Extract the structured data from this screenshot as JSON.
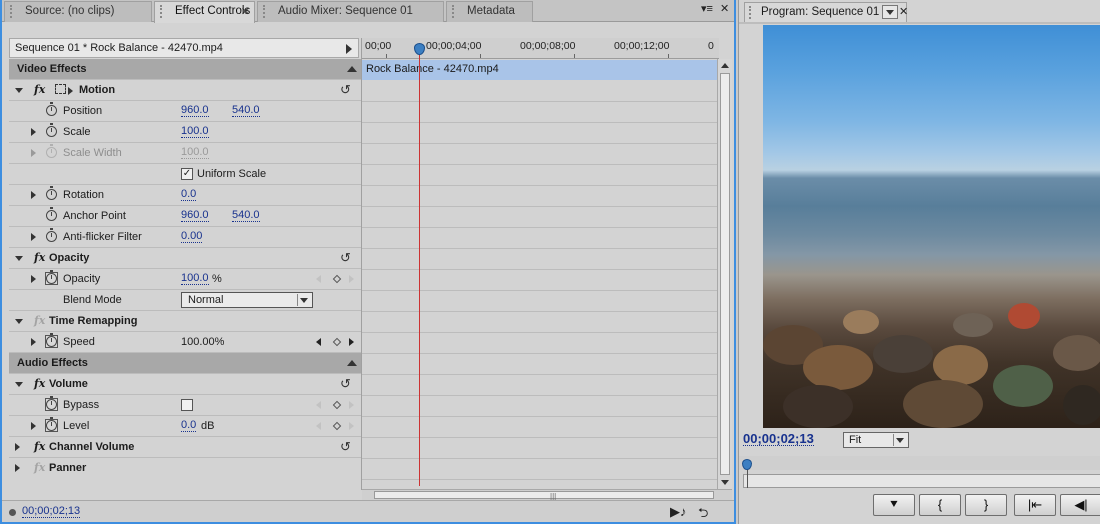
{
  "tabs": [
    {
      "label": "Source: (no clips)",
      "active": false
    },
    {
      "label": "Effect Controls",
      "active": true
    },
    {
      "label": "Audio Mixer: Sequence 01",
      "active": false
    },
    {
      "label": "Metadata",
      "active": false
    }
  ],
  "sequence_header": "Sequence 01 * Rock Balance - 42470.mp4",
  "ruler_ticks": [
    "00;00",
    "00;00;04;00",
    "00;00;08;00",
    "00;00;12;00",
    "0"
  ],
  "clip_name": "Rock Balance - 42470.mp4",
  "sections": {
    "video": "Video Effects",
    "audio": "Audio Effects"
  },
  "motion": {
    "name": "Motion",
    "position": {
      "label": "Position",
      "x": "960.0",
      "y": "540.0"
    },
    "scale": {
      "label": "Scale",
      "value": "100.0"
    },
    "scale_width": {
      "label": "Scale Width",
      "value": "100.0"
    },
    "uniform_scale": {
      "label": "Uniform Scale",
      "checked": true
    },
    "rotation": {
      "label": "Rotation",
      "value": "0.0"
    },
    "anchor_point": {
      "label": "Anchor Point",
      "x": "960.0",
      "y": "540.0"
    },
    "anti_flicker": {
      "label": "Anti-flicker Filter",
      "value": "0.00"
    }
  },
  "opacity": {
    "name": "Opacity",
    "opacity": {
      "label": "Opacity",
      "value": "100.0",
      "unit": "%"
    },
    "blend_mode": {
      "label": "Blend Mode",
      "value": "Normal"
    }
  },
  "time_remapping": {
    "name": "Time Remapping",
    "speed": {
      "label": "Speed",
      "value": "100.00%"
    }
  },
  "volume": {
    "name": "Volume",
    "bypass": {
      "label": "Bypass",
      "checked": false
    },
    "level": {
      "label": "Level",
      "value": "0.0",
      "unit": "dB"
    }
  },
  "channel_volume": {
    "name": "Channel Volume"
  },
  "panner": {
    "name": "Panner"
  },
  "footer_timecode": "00;00;02;13",
  "program": {
    "tab_label": "Program: Sequence 01",
    "timecode": "00;00;02;13",
    "zoom": "Fit",
    "transport": [
      "marker-icon",
      "mark-in-icon",
      "mark-out-icon",
      "go-to-in-icon",
      "step-back-icon"
    ]
  },
  "colors": {
    "accent_border": "#3d8ee0",
    "clip_bar": "#a9c4e8",
    "playhead": "#cc3333",
    "timecode": "#18328e"
  }
}
